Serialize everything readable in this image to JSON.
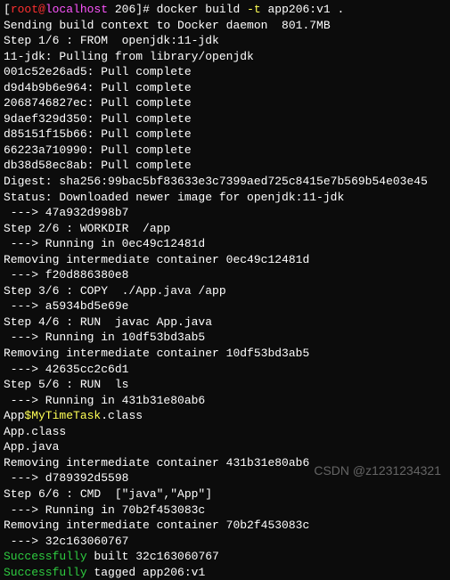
{
  "prompt": {
    "bracket_open": "[",
    "user": "root@",
    "host": "localhost",
    "path": " 206",
    "bracket_close": "]# ",
    "command": "docker build ",
    "flag": "-t",
    "args": " app206:v1 ."
  },
  "lines": {
    "l1": "Sending build context to Docker daemon  801.7MB",
    "l2": "Step 1/6 : FROM  openjdk:11-jdk",
    "l3": "11-jdk: Pulling from library/openjdk",
    "l4": "001c52e26ad5: Pull complete",
    "l5": "d9d4b9b6e964: Pull complete",
    "l6": "2068746827ec: Pull complete",
    "l7": "9daef329d350: Pull complete",
    "l8": "d85151f15b66: Pull complete",
    "l9": "66223a710990: Pull complete",
    "l10": "db38d58ec8ab: Pull complete",
    "l11": "Digest: sha256:99bac5bf83633e3c7399aed725c8415e7b569b54e03e45",
    "l12": "Status: Downloaded newer image for openjdk:11-jdk",
    "l13": " ---> 47a932d998b7",
    "l14": "Step 2/6 : WORKDIR  /app",
    "l15": " ---> Running in 0ec49c12481d",
    "l16": "Removing intermediate container 0ec49c12481d",
    "l17": " ---> f20d886380e8",
    "l18": "Step 3/6 : COPY  ./App.java /app",
    "l19": " ---> a5934bd5e69e",
    "l20": "Step 4/6 : RUN  javac App.java",
    "l21": " ---> Running in 10df53bd3ab5",
    "l22": "Removing intermediate container 10df53bd3ab5",
    "l23": " ---> 42635cc2c6d1",
    "l24": "Step 5/6 : RUN  ls",
    "l25": " ---> Running in 431b31e80ab6",
    "l26_a": "App",
    "l26_b": "$MyTimeTask",
    "l26_c": ".class",
    "l27": "App.class",
    "l28": "App.java",
    "l29": "Removing intermediate container 431b31e80ab6",
    "l30": " ---> d789392d5598",
    "l31": "Step 6/6 : CMD  [\"java\",\"App\"]",
    "l32": " ---> Running in 70b2f453083c",
    "l33": "Removing intermediate container 70b2f453083c",
    "l34": " ---> 32c163060767",
    "l35_a": "Successfully",
    "l35_b": " built 32c163060767",
    "l36_a": "Successfully",
    "l36_b": " tagged app206:v1"
  },
  "watermark": "CSDN @z1231234321"
}
